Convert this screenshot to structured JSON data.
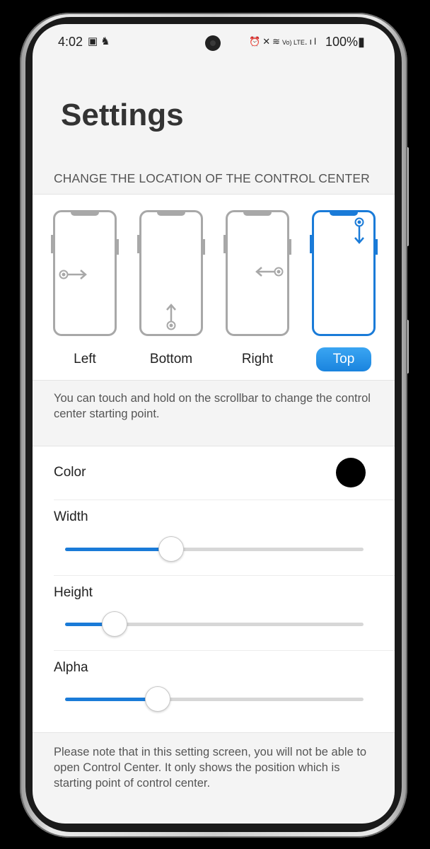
{
  "status_bar": {
    "time": "4:02",
    "left_icons": [
      "image-icon",
      "notification-icon"
    ],
    "right_icons": [
      "alarm-icon",
      "mute-icon",
      "wifi-icon",
      "volte-icon",
      "signal-icon"
    ],
    "volte_text": "Vo) LTE",
    "battery": "100%"
  },
  "page": {
    "title": "Settings"
  },
  "location": {
    "header": "CHANGE THE LOCATION OF THE CONTROL CENTER",
    "options": [
      {
        "label": "Left",
        "selected": false
      },
      {
        "label": "Bottom",
        "selected": false
      },
      {
        "label": "Right",
        "selected": false
      },
      {
        "label": "Top",
        "selected": true
      }
    ],
    "hint": "You can touch and hold on the scrollbar to change the control center starting point."
  },
  "settings": {
    "color": {
      "label": "Color",
      "value": "#000000"
    },
    "width": {
      "label": "Width",
      "value": 0.355
    },
    "height": {
      "label": "Height",
      "value": 0.165
    },
    "alpha": {
      "label": "Alpha",
      "value": 0.31
    }
  },
  "footer_note": "Please note that in this setting screen, you will not be able to open Control Center. It only shows the position which is starting point of control center.",
  "colors": {
    "accent": "#1a7bd8",
    "track": "#d7d7d7",
    "background": "#f4f4f4"
  }
}
